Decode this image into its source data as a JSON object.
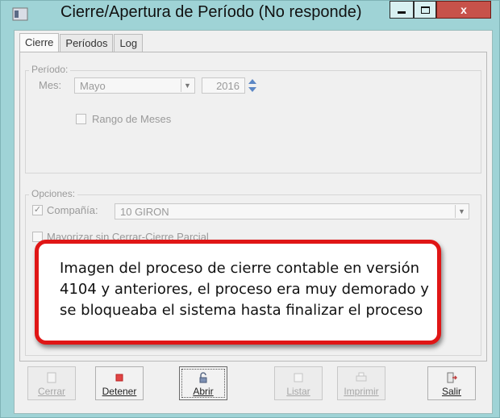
{
  "window": {
    "title": "Cierre/Apertura de Período (No responde)",
    "close_glyph": "x"
  },
  "tabs": [
    {
      "label": "Cierre",
      "active": true
    },
    {
      "label": "Períodos",
      "active": false
    },
    {
      "label": "Log",
      "active": false
    }
  ],
  "periodo": {
    "group_title": "Período:",
    "mes_label": "Mes:",
    "mes_value": "Mayo",
    "year_value": "2016",
    "rango_label": "Rango de Meses",
    "rango_checked": false
  },
  "opciones": {
    "group_title": "Opciones:",
    "compania_label": "Compañía:",
    "compania_checked": true,
    "compania_value": "10  GIRON",
    "mayorizar_label": "Mayorizar sin Cerrar-Cierre Parcial",
    "mayorizar_checked": false
  },
  "annotation": {
    "text": "Imagen del proceso de cierre contable en versión 4104 y anteriores, el proceso era muy demorado y se bloqueaba el sistema hasta finalizar el proceso"
  },
  "toolbar": [
    {
      "label": "Cerrar",
      "enabled": false,
      "icon": "document-icon"
    },
    {
      "label": "Detener",
      "enabled": true,
      "icon": "stop-icon"
    },
    {
      "label": "Abrir",
      "enabled": true,
      "icon": "unlock-icon"
    },
    {
      "label": "Listar",
      "enabled": false,
      "icon": "list-icon"
    },
    {
      "label": "Imprimir",
      "enabled": false,
      "icon": "printer-icon"
    },
    {
      "label": "Salir",
      "enabled": true,
      "icon": "exit-icon"
    }
  ],
  "colors": {
    "frame": "#9fd3d6",
    "close_button": "#c7524a",
    "callout_border": "#e01616",
    "stop_red": "#e04545",
    "accent_blue": "#5b87c5"
  }
}
